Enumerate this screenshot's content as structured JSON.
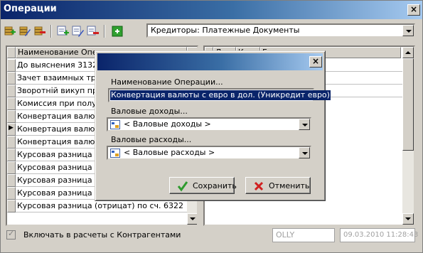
{
  "window": {
    "title": "Операции"
  },
  "toolbar": {
    "icons": [
      "add-record-icon",
      "edit-record-icon",
      "delete-record-icon",
      "add-child-icon",
      "edit-child-icon",
      "delete-child-icon",
      "refresh-icon"
    ],
    "selector_value": "Кредиторы: Платежные Документы"
  },
  "left_grid": {
    "header": "Наименование Опера",
    "rows": [
      "До выяснения  3132",
      "Зачет взаимных треб",
      "Зворотній викуп прав",
      "Комиссия при получе",
      "Конвертация валюты",
      "Конвертация валюты",
      "Конвертация валюты",
      "Курсовая разница ( п",
      "Курсовая разница (от",
      "Курсовая разница (от",
      "Курсовая разница (от",
      "Курсовая разница (отрицат) по сч. 6322"
    ],
    "current_row_marker": "▶"
  },
  "right_grid": {
    "header": [
      "Д",
      "К",
      "Г"
    ],
    "rows": [
      "ларов США",
      "ларов США",
      "ларов США"
    ]
  },
  "status": {
    "checkbox_label": "Включать в расчеты с Контрагентами",
    "user": "OLLY",
    "timestamp": "09.03.2010 11:28:43"
  },
  "dialog": {
    "close": "×",
    "name_label": "Наименование Операции...",
    "name_value": "Конвертация валюты с евро в дол. (Уникредит евро)",
    "income_label": "Валовые доходы...",
    "income_value": "< Валовые доходы >",
    "expense_label": "Валовые расходы...",
    "expense_value": "< Валовые расходы >",
    "save_label": "Сохранить",
    "cancel_label": "Отменить"
  },
  "colors": {
    "title_start": "#0a246a",
    "title_end": "#a6caf0",
    "save_check": "#2e9b2e",
    "cancel_x": "#d02020"
  }
}
